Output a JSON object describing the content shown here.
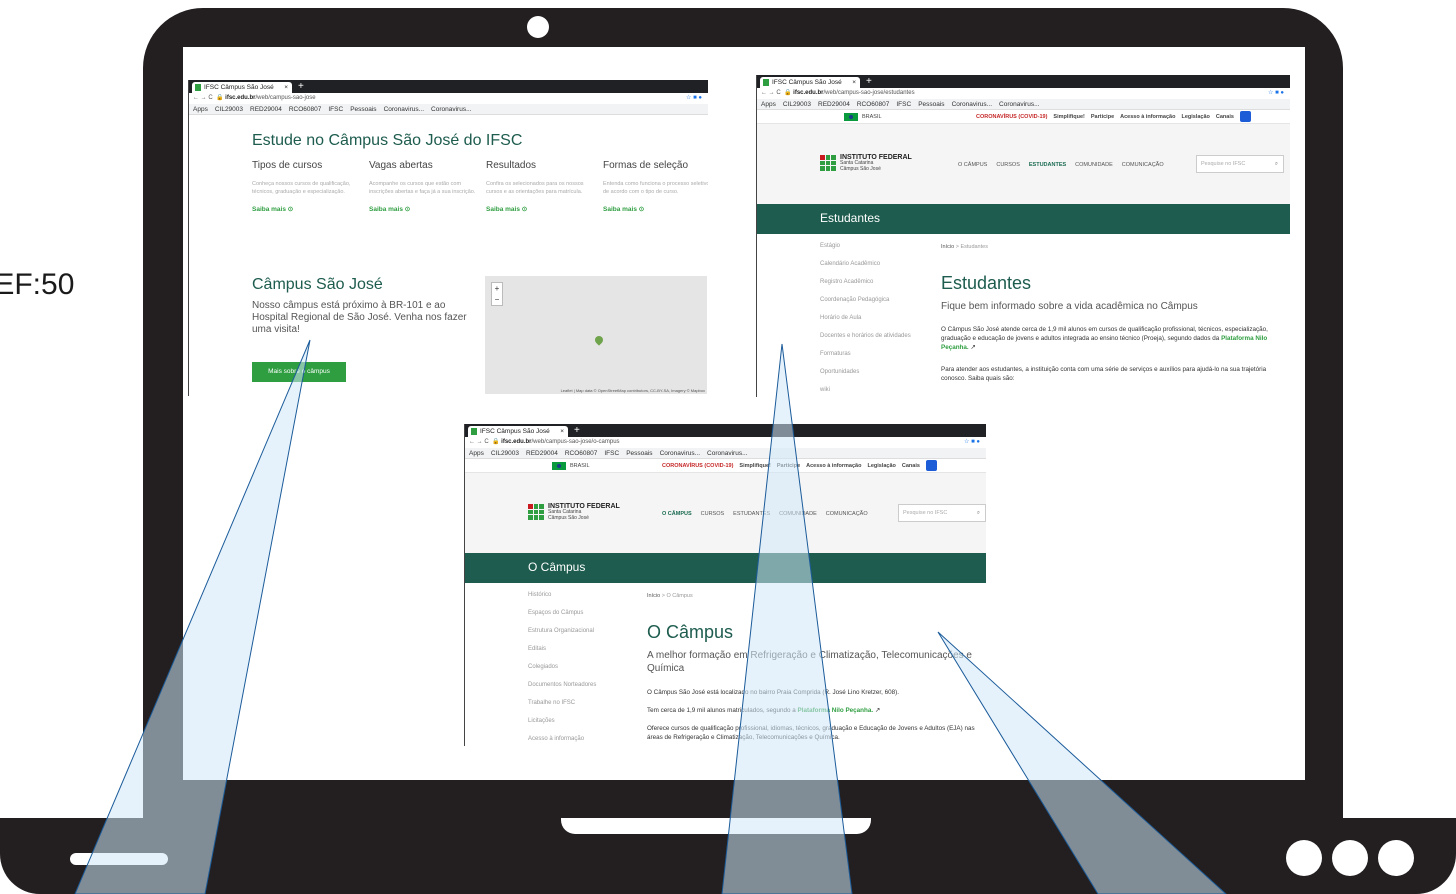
{
  "fragment_text": ":EF:50",
  "browser": {
    "tab_title": "IFSC Câmpus São José",
    "tab_close": "×",
    "new_tab": "+",
    "nav_glyphs": "← → C",
    "bookmarks": [
      "Apps",
      "CIL29003",
      "RED29004",
      "RCO60807",
      "IFSC",
      "Pessoais",
      "Coronavirus...",
      "Coronavirus..."
    ],
    "bookmarks_w1": [
      "Apps",
      "CIL29003",
      "RED29004",
      "RCO60807",
      "IFSC",
      "Pessoais",
      "Coronavirus...",
      "Coronavirus..."
    ]
  },
  "gov_bar": {
    "brasil": "BRASIL",
    "covid": "CORONAVÍRUS (COVID-19)",
    "links": [
      "Simplifique!",
      "Participe",
      "Acesso à informação",
      "Legislação",
      "Canais"
    ]
  },
  "ifsc_logo": {
    "name": "INSTITUTO FEDERAL",
    "state": "Santa Catarina",
    "campus": "Câmpus São José"
  },
  "main_nav": [
    "O CÂMPUS",
    "CURSOS",
    "ESTUDANTES",
    "COMUNIDADE",
    "COMUNICAÇÃO"
  ],
  "search_placeholder": "Pesquise no IFSC",
  "window1": {
    "url_host": "ifsc.edu.br",
    "url_path": "/web/campus-sao-jose",
    "heading": "Estude no Câmpus São José do IFSC",
    "columns": [
      {
        "title": "Tipos de cursos",
        "desc": "Conheça nossos cursos de qualificação, técnicos, graduação e especialização.",
        "link": "Saiba mais"
      },
      {
        "title": "Vagas abertas",
        "desc": "Acompanhe os cursos que estão com inscrições abertas e faça já a sua inscrição.",
        "link": "Saiba mais"
      },
      {
        "title": "Resultados",
        "desc": "Confira os selecionados para os nossos cursos e as orientações para matrícula.",
        "link": "Saiba mais"
      },
      {
        "title": "Formas de seleção",
        "desc": "Entenda como funciona o processo seletivo de acordo com o tipo de curso.",
        "link": "Saiba mais"
      }
    ],
    "campus_title": "Câmpus São José",
    "campus_text": "Nosso câmpus está próximo à BR-101 e ao Hospital Regional de São José. Venha nos fazer uma visita!",
    "campus_button": "Mais sobre o câmpus",
    "map_zoom_in": "+",
    "map_zoom_out": "−",
    "map_attribution": "Leaflet | Map data © OpenStreetMap contributors, CC-BY-SA, Imagery © Mapbox"
  },
  "window2": {
    "url_host": "ifsc.edu.br",
    "url_path": "/web/campus-sao-jose/estudantes",
    "band_title": "Estudantes",
    "sidebar": [
      "Estágio",
      "Calendário Acadêmico",
      "Registro Acadêmico",
      "Coordenação Pedagógica",
      "Horário de Aula",
      "Docentes e horários de atividades",
      "Formaturas",
      "Oportunidades",
      "wiki"
    ],
    "breadcrumb_home": "Início",
    "breadcrumb_sep": ">",
    "breadcrumb_current": "Estudantes",
    "title": "Estudantes",
    "subtitle": "Fique bem informado sobre a vida acadêmica no Câmpus",
    "p1": "O Câmpus São José atende cerca de 1,9 mil alunos em cursos de qualificação profissional, técnicos, especialização, graduação e educação de jovens e adultos integrada ao ensino técnico (Proeja), segundo dados da",
    "p1_link": "Plataforma Nilo Peçanha.",
    "p2": "Para atender aos estudantes, a instituição conta com uma série de serviços e auxílios para ajudá-lo na sua trajetória conosco. Saiba quais são:"
  },
  "window3": {
    "url_host": "ifsc.edu.br",
    "url_path": "/web/campus-sao-jose/o-campus",
    "band_title": "O Câmpus",
    "sidebar": [
      "Histórico",
      "Espaços do Câmpus",
      "Estrutura Organizacional",
      "Editais",
      "Colegiados",
      "Documentos Norteadores",
      "Trabalhe no IFSC",
      "Licitações",
      "Acesso à informação"
    ],
    "breadcrumb_home": "Início",
    "breadcrumb_sep": ">",
    "breadcrumb_current": "O Câmpus",
    "title": "O Câmpus",
    "subtitle": "A melhor formação em Refrigeração e Climatização, Telecomunicações e Química",
    "p1": "O Câmpus São José está localizado no bairro Praia Comprida (R. José Lino Kretzer, 608).",
    "p2": "Tem cerca de 1,9 mil alunos matriculados, segundo a",
    "p2_link": "Plataforma Nilo Peçanha.",
    "p3": "Oferece cursos de qualificação profissional, idiomas, técnicos, graduação e Educação de Jovens e Adultos (EJA) nas áreas de Refrigeração e Climatização, Telecomunicações e Química."
  },
  "colors": {
    "laptop": "#231f20",
    "ifsc_green": "#2f9e41",
    "band": "#1d5c4e",
    "ray": "#cfe8f8"
  }
}
